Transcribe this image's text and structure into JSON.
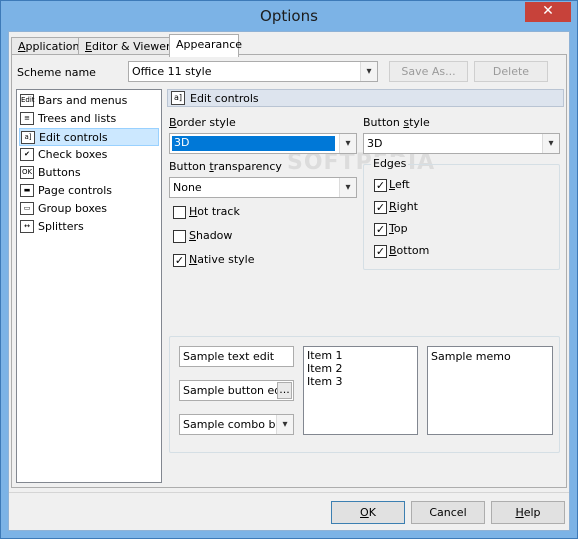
{
  "window": {
    "title": "Options",
    "close_glyph": "✕"
  },
  "tabs": [
    {
      "label": "Application",
      "underline": "A",
      "rest": "pplication"
    },
    {
      "label": "Editor & Viewers",
      "underline": "E",
      "rest": "ditor & Viewers"
    },
    {
      "label": "Appearance",
      "underline": "",
      "rest": "Appearance"
    }
  ],
  "scheme": {
    "label": "Scheme name",
    "value": "Office 11 style",
    "save_as": "Save As...",
    "delete": "Delete"
  },
  "tree": {
    "items": [
      {
        "label": "Bars and menus",
        "icon": "bars-icon",
        "glyph": "Edit"
      },
      {
        "label": "Trees and lists",
        "icon": "tree-icon",
        "glyph": "≡"
      },
      {
        "label": "Edit controls",
        "icon": "edit-control-icon",
        "glyph": "a]"
      },
      {
        "label": "Check boxes",
        "icon": "checkbox-icon",
        "glyph": "✔"
      },
      {
        "label": "Buttons",
        "icon": "button-icon",
        "glyph": "OK"
      },
      {
        "label": "Page controls",
        "icon": "page-control-icon",
        "glyph": "▬"
      },
      {
        "label": "Group boxes",
        "icon": "groupbox-icon",
        "glyph": "▭"
      },
      {
        "label": "Splitters",
        "icon": "splitter-icon",
        "glyph": "↔"
      }
    ],
    "selected_index": 2
  },
  "section": {
    "title": "Edit controls",
    "glyph": "a]"
  },
  "border_style": {
    "label_u": "B",
    "label_rest": "order style",
    "value": "3D"
  },
  "button_style": {
    "label_pre": "Button ",
    "label_u": "s",
    "label_rest": "tyle",
    "value": "3D"
  },
  "button_transparency": {
    "label_pre": "Button ",
    "label_u": "t",
    "label_rest": "ransparency",
    "value": "None"
  },
  "options": {
    "hot_track": {
      "u": "H",
      "rest": "ot track",
      "checked": false
    },
    "shadow": {
      "u": "S",
      "rest": "hadow",
      "checked": false
    },
    "native_style": {
      "u": "N",
      "rest": "ative style",
      "checked": true
    }
  },
  "edges": {
    "title": "Edges",
    "left": {
      "u": "L",
      "rest": "eft",
      "checked": true
    },
    "right": {
      "u": "R",
      "rest": "ight",
      "checked": true
    },
    "top": {
      "u": "T",
      "rest": "op",
      "checked": true
    },
    "bottom": {
      "u": "B",
      "rest": "ottom",
      "checked": true
    }
  },
  "samples": {
    "text_edit": "Sample text edit",
    "button_edit": "Sample button edit",
    "button_edit_glyph": "...",
    "combo_box": "Sample combo box",
    "list_items": [
      "Item 1",
      "Item 2",
      "Item 3"
    ],
    "memo": "Sample memo"
  },
  "footer": {
    "ok_u": "O",
    "ok_rest": "K",
    "cancel": "Cancel",
    "help_u": "H",
    "help_rest": "elp"
  },
  "watermark": "SOFTPEDIA"
}
